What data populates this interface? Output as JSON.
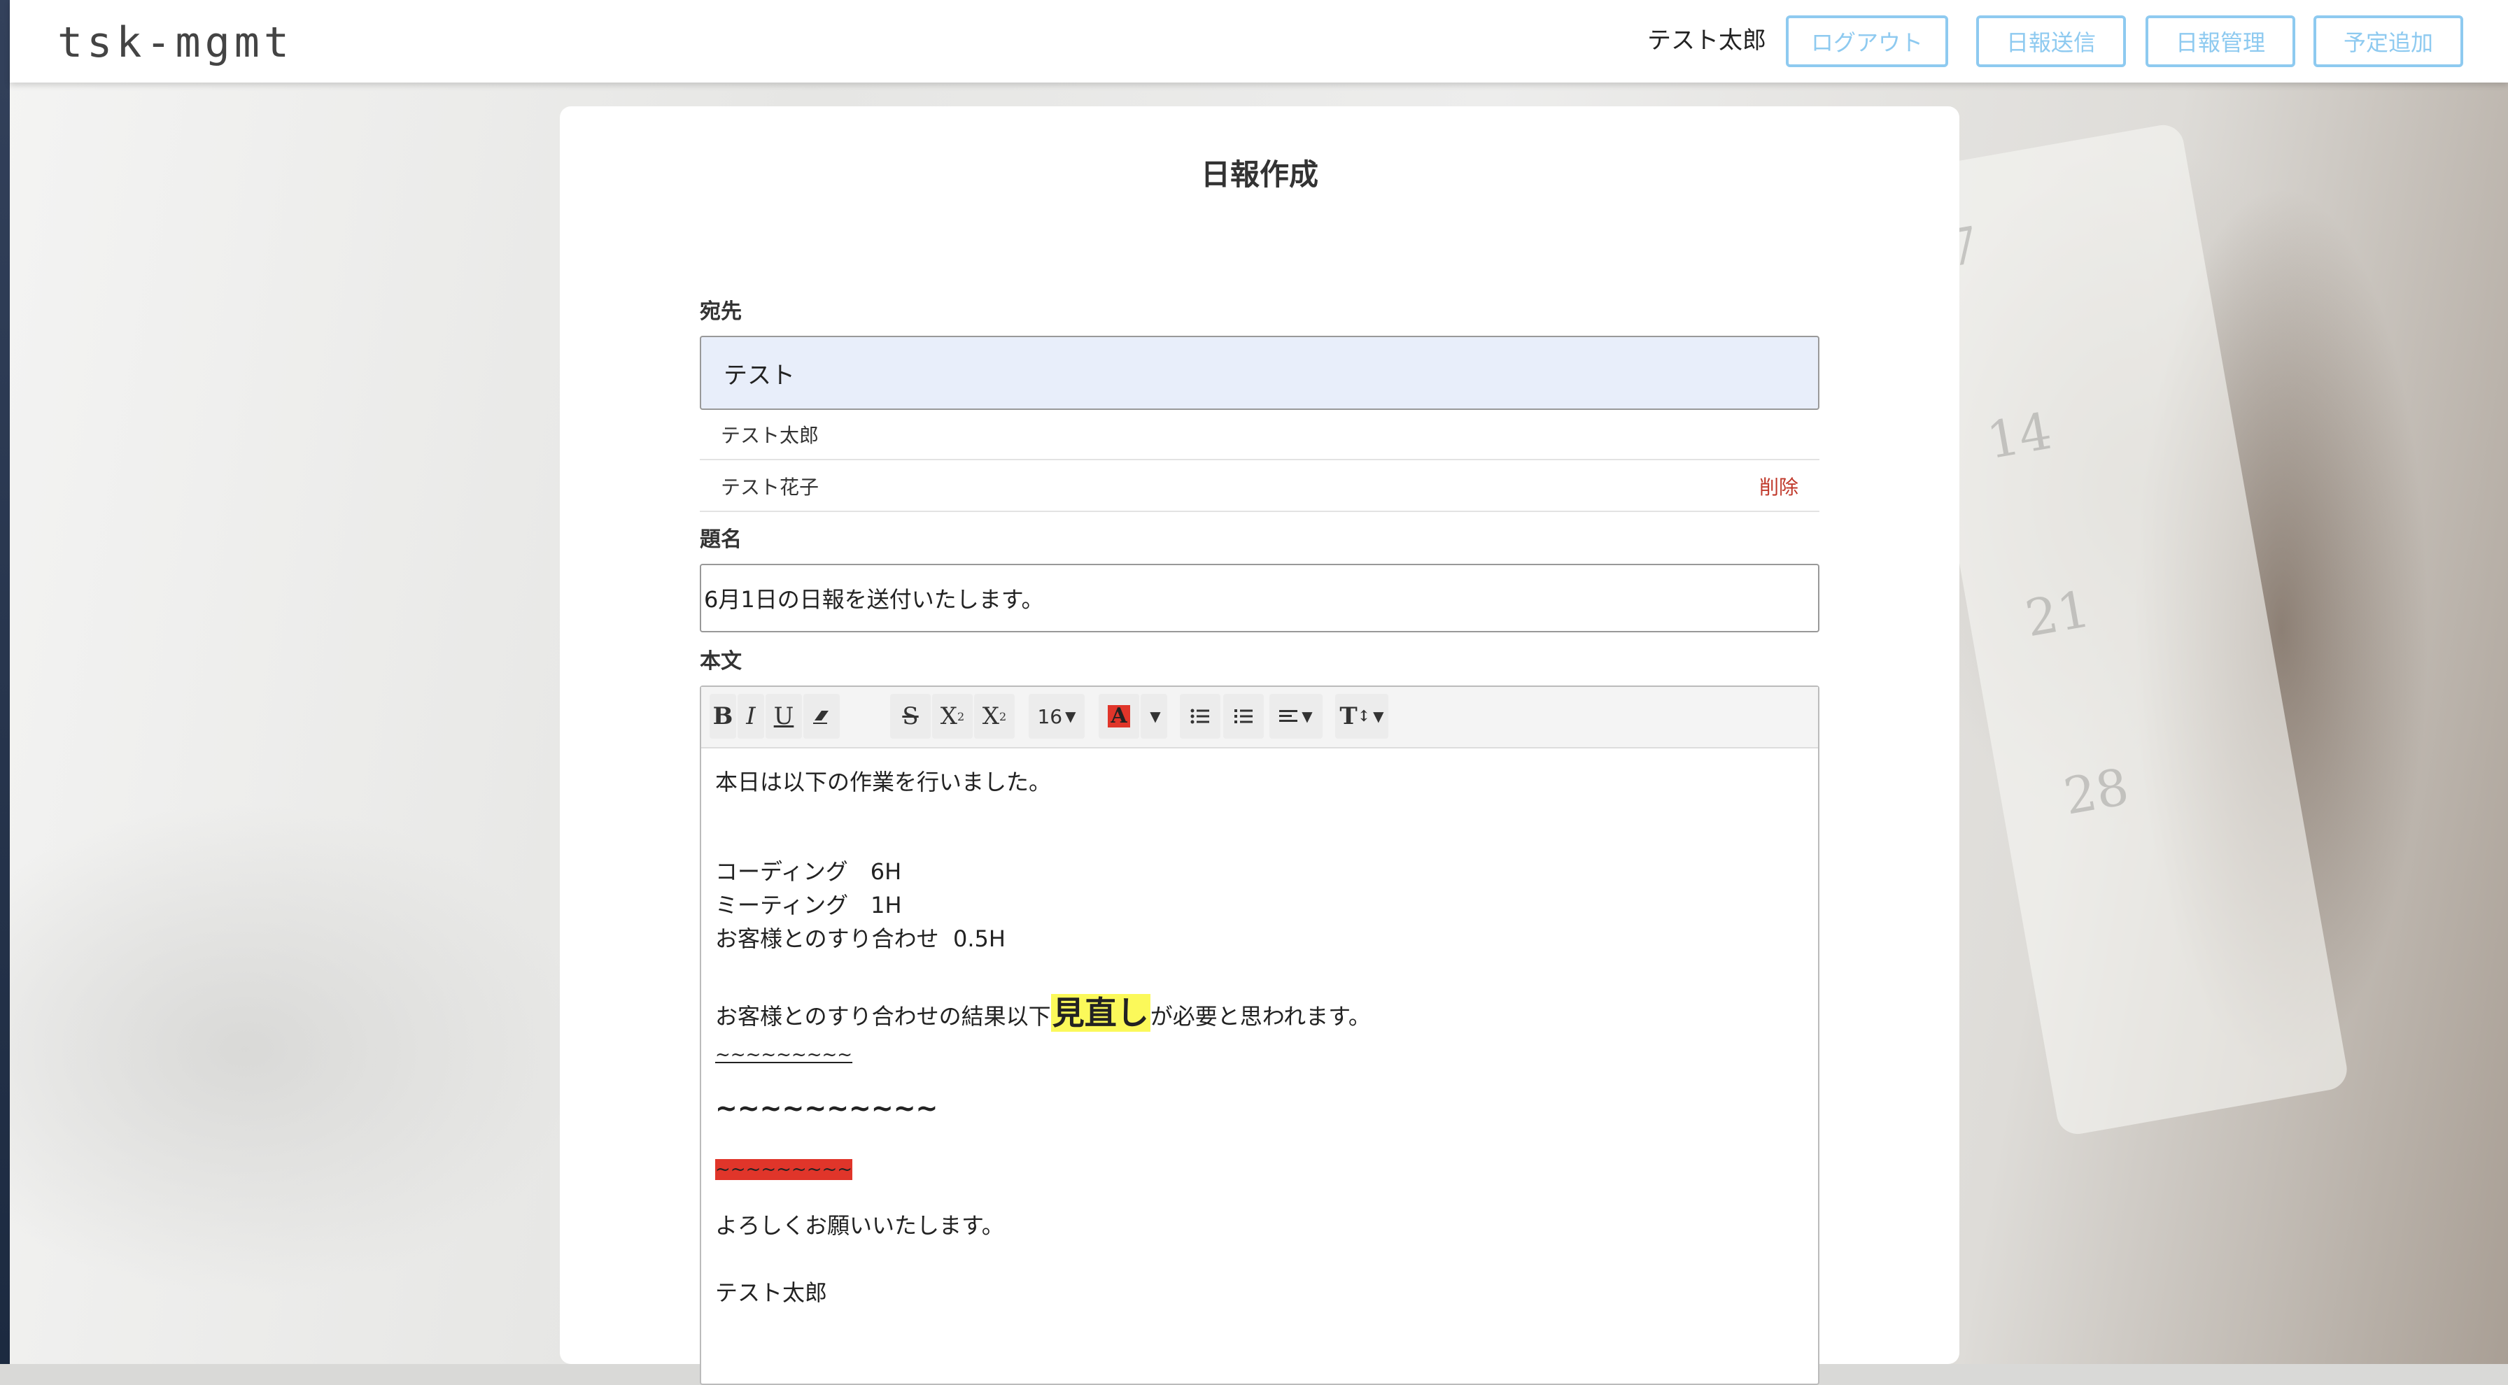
{
  "app": {
    "logo": "tsk-mgmt"
  },
  "header": {
    "username": "テスト太郎",
    "nav": [
      {
        "label": "ログアウト"
      },
      {
        "label": "日報送信"
      },
      {
        "label": "日報管理"
      },
      {
        "label": "予定追加"
      }
    ]
  },
  "background": {
    "calendar_numbers": [
      "7",
      "14",
      "21",
      "28"
    ]
  },
  "page": {
    "title": "日報作成"
  },
  "form": {
    "to": {
      "label": "宛先",
      "value": "テスト",
      "recipients": [
        {
          "name": "テスト太郎"
        },
        {
          "name": "テスト花子",
          "action": "削除"
        }
      ]
    },
    "subject": {
      "label": "題名",
      "value": "6月1日の日報を送付いたします。"
    },
    "body": {
      "label": "本文",
      "toolbar": {
        "font_size": "16",
        "icons": [
          "bold-icon",
          "italic-icon",
          "underline-icon",
          "eraser-icon",
          "strikethrough-icon",
          "superscript-icon",
          "subscript-icon",
          "font-size-dropdown",
          "font-color-icon",
          "color-caret-icon",
          "unordered-list-icon",
          "ordered-list-icon",
          "align-icon",
          "line-height-icon"
        ]
      },
      "lines": {
        "l1": "本日は以下の作業を行いました。",
        "l2": "コーディング　6H",
        "l3": "ミーティング　1H",
        "l4": "お客様とのすり合わせ  0.5H",
        "l5_pre": "お客様とのすり合わせの結果以下",
        "l5_highlight": "見直し",
        "l5_post": "が必要と思われます。",
        "l6": "~~~~~~~~~",
        "l7": "~~~~~~~~~~",
        "l8": "~~~~~~~~~",
        "l9": "よろしくお願いいたします。",
        "l10": "テスト太郎"
      },
      "colors": {
        "highlight": "#fbf95a",
        "red_background": "#e0352a"
      }
    }
  },
  "colors": {
    "nav_accent": "#8ecaf0",
    "delete_link": "#c0392b"
  }
}
